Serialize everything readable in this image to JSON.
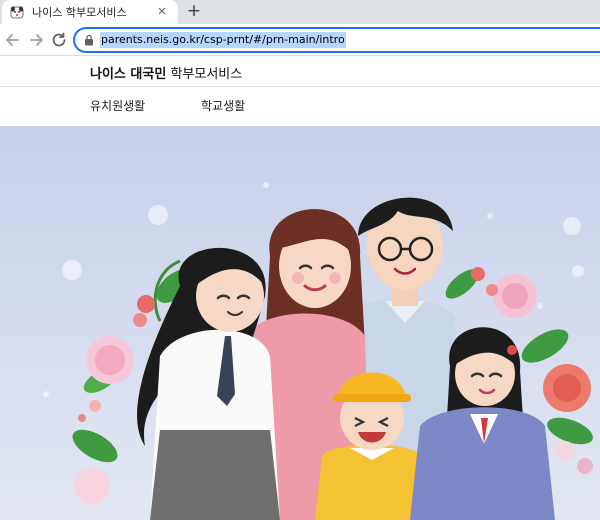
{
  "browser": {
    "tab": {
      "title": "나이스 학부모서비스",
      "favicon": "dalmatian-favicon-icon",
      "close_icon": "close-icon"
    },
    "new_tab_icon": "plus-icon",
    "toolbar": {
      "back_icon": "arrow-left-icon",
      "forward_icon": "arrow-right-icon",
      "reload_icon": "reload-icon",
      "lock_icon": "lock-icon",
      "url": "parents.neis.go.kr/csp-prnt/#/prn-main/intro"
    }
  },
  "site": {
    "logo": {
      "brand": "나이스 대국민",
      "service": "학부모서비스"
    },
    "nav": [
      {
        "label": "유치원생활"
      },
      {
        "label": "학교생활"
      }
    ]
  },
  "hero": {
    "illustration": "family-illustration",
    "colors": {
      "background": "#c6d0ea",
      "accent": "#1a73e8"
    }
  }
}
